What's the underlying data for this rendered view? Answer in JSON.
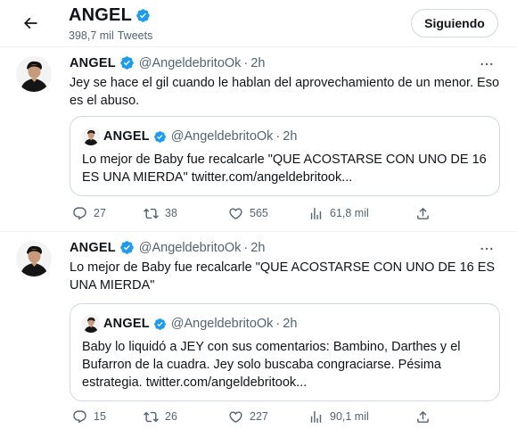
{
  "header": {
    "name": "ANGEL",
    "tweet_count": "398,7 mil",
    "tweets_label": "Tweets",
    "follow_label": "Siguiendo"
  },
  "tweets": [
    {
      "name": "ANGEL",
      "handle": "@AngeldebritoOk",
      "dot": "·",
      "time": "2h",
      "text": "Jey se hace el gil cuando le hablan del aprovechamiento de un menor. Eso es el abuso.",
      "quote": {
        "name": "ANGEL",
        "handle": "@AngeldebritoOk",
        "dot": "·",
        "time": "2h",
        "text": "Lo mejor de Baby fue recalcarle \"QUE ACOSTARSE CON UNO DE 16 ES UNA MIERDA\" twitter.com/angeldebritook..."
      },
      "replies": "27",
      "retweets": "38",
      "likes": "565",
      "views": "61,8 mil"
    },
    {
      "name": "ANGEL",
      "handle": "@AngeldebritoOk",
      "dot": "·",
      "time": "2h",
      "text": "Lo mejor de Baby fue recalcarle \"QUE ACOSTARSE CON UNO DE 16 ES UNA MIERDA\"",
      "quote": {
        "name": "ANGEL",
        "handle": "@AngeldebritoOk",
        "dot": "·",
        "time": "2h",
        "text": "Baby lo liquidó a JEY con sus comentarios: Bambino, Darthes y el Bufarron de la cuadra. Jey solo buscaba congraciarse. Pésima estrategia. twitter.com/angeldebritook..."
      },
      "replies": "15",
      "retweets": "26",
      "likes": "227",
      "views": "90,1 mil"
    }
  ],
  "colors": {
    "verified": "#1d9bf0",
    "secondary_text": "#536471",
    "border": "#cfd9de"
  },
  "icons": {
    "back": "arrow-left-icon",
    "verified": "verified-badge-icon",
    "more": "more-icon",
    "reply": "reply-icon",
    "retweet": "retweet-icon",
    "like": "heart-icon",
    "views": "views-icon",
    "share": "share-icon"
  }
}
